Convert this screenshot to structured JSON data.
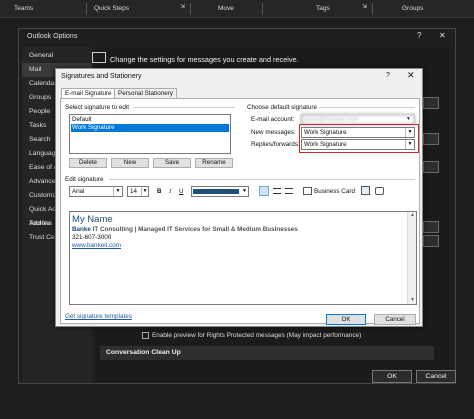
{
  "ribbon": {
    "groups": [
      "Teams",
      "Quick Steps",
      "Move",
      "Tags",
      "Groups"
    ]
  },
  "options": {
    "title": "Outlook Options",
    "help": "?",
    "close": "✕",
    "nav": [
      "General",
      "Mail",
      "Calendar",
      "Groups",
      "People",
      "Tasks",
      "Search",
      "Language",
      "Ease of Access",
      "Advanced",
      "Customize Ribbon",
      "Quick Access Toolbar",
      "Add-ins",
      "Trust Center"
    ],
    "header_text": "Change the settings for messages you create and receive.",
    "irm_checkbox": "Enable preview for Rights Protected messages (May impact performance)",
    "section": "Conversation Clean Up",
    "ok": "OK",
    "cancel": "Cancel"
  },
  "dialog": {
    "title": "Signatures and Stationery",
    "help": "?",
    "close": "✕",
    "tabs": [
      "E-mail Signature",
      "Personal Stationery"
    ],
    "select_label": "Select signature to edit",
    "signatures": [
      "Default",
      "Work Signature"
    ],
    "buttons": {
      "delete": "Delete",
      "new": "New",
      "save": "Save",
      "rename": "Rename"
    },
    "default_label": "Choose default signature",
    "email_account_label": "E-mail account:",
    "email_account_value": "jason@bankeit.com",
    "new_messages_label": "New messages:",
    "new_messages_value": "Work Signature",
    "replies_label": "Replies/forwards:",
    "replies_value": "Work Signature",
    "edit_label": "Edit signature",
    "font": "Arial",
    "size": "14",
    "color": "#1f4e79",
    "business_card": "Business Card",
    "sig_name": "My Name",
    "sig_company_bold": "Banke",
    "sig_company_rest": " IT Consulting | Managed IT Services for Small & Medium Businesses",
    "sig_phone": "321-607-3000",
    "sig_web": "www.bankeit.com",
    "templates_link": "Get signature templates",
    "ok": "OK",
    "cancel": "Cancel"
  }
}
